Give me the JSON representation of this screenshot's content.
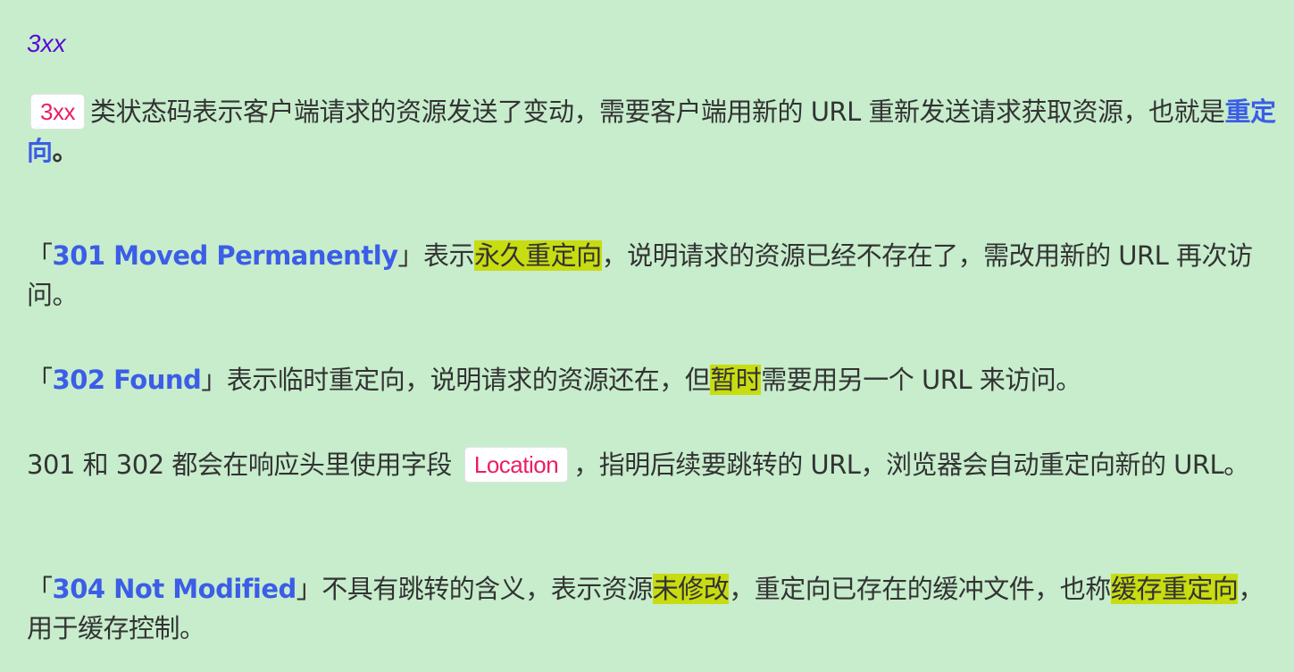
{
  "heading": "3xx",
  "p1": {
    "code": "3xx",
    "text1": "类状态码表示客户端请求的资源发送了变动，需要客户端用新的 URL 重新发送请求获取资源，也就是",
    "strong": "重定向",
    "text2": "。"
  },
  "p2": {
    "open": "「",
    "strong": "301 Moved Permanently",
    "close_text": "」表示",
    "mark": "永久重定向",
    "text": "，说明请求的资源已经不存在了，需改用新的 URL 再次访问。"
  },
  "p3": {
    "open": "「",
    "strong": "302 Found",
    "text1": "」表示临时重定向，说明请求的资源还在，但",
    "mark": "暂时",
    "text2": "需要用另一个 URL 来访问。"
  },
  "p4": {
    "text1": "301 和 302 都会在响应头里使用字段",
    "code": "Location",
    "text2": "，指明后续要跳转的 URL，浏览器会自动重定向新的 URL。"
  },
  "p5": {
    "open": "「",
    "strong": "304 Not Modified",
    "text1": "」不具有跳转的含义，表示资源",
    "mark1": "未修改",
    "text2": "，重定向已存在的缓冲文件，也称",
    "mark2": "缓存重定向",
    "text3": "，用于缓存控制。"
  },
  "colors": {
    "background": "#c7edcc",
    "heading": "#5a0ad6",
    "strong": "#3b5de7",
    "code_text": "#e91e63",
    "highlight": "#c8dc12"
  }
}
